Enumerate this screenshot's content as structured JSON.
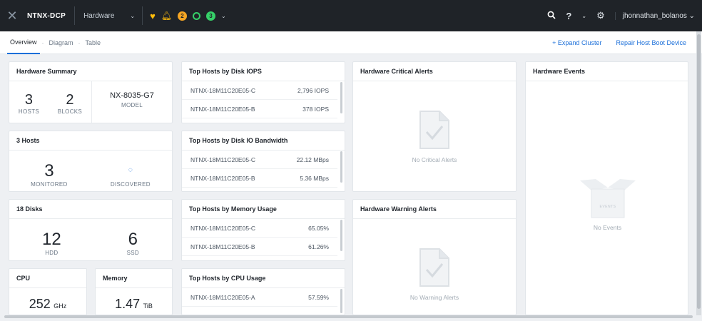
{
  "header": {
    "cluster": "NTNX-DCP",
    "entity": "Hardware",
    "health_icon": "heart-pulse-icon",
    "alerts_count": "2",
    "alerts_color": "#f6a623",
    "tasks_count": "3",
    "tasks_color": "#36d068",
    "user": "jhonnathan_bolanos"
  },
  "subnav": {
    "tabs": [
      "Overview",
      "Diagram",
      "Table"
    ],
    "expand_cluster": "+ Expand Cluster",
    "repair": "Repair Host Boot Device"
  },
  "hardware_summary": {
    "title": "Hardware Summary",
    "hosts_value": "3",
    "hosts_label": "HOSTS",
    "blocks_value": "2",
    "blocks_label": "BLOCKS",
    "model_value": "NX-8035-G7",
    "model_label": "MODEL"
  },
  "hosts": {
    "title": "3 Hosts",
    "monitored_value": "3",
    "monitored_label": "MONITORED",
    "discovered_label": "DISCOVERED"
  },
  "disks": {
    "title": "18 Disks",
    "hdd_value": "12",
    "hdd_label": "HDD",
    "ssd_value": "6",
    "ssd_label": "SSD"
  },
  "cpu": {
    "title": "CPU",
    "value": "252",
    "unit": "GHz"
  },
  "memory": {
    "title": "Memory",
    "value": "1.47",
    "unit": "TiB"
  },
  "iops": {
    "title": "Top Hosts by Disk IOPS",
    "rows": [
      {
        "host": "NTNX-18M11C20E05-C",
        "value": "2,796 IOPS"
      },
      {
        "host": "NTNX-18M11C20E05-B",
        "value": "378 IOPS"
      }
    ]
  },
  "bandwidth": {
    "title": "Top Hosts by Disk IO Bandwidth",
    "rows": [
      {
        "host": "NTNX-18M11C20E05-C",
        "value": "22.12 MBps"
      },
      {
        "host": "NTNX-18M11C20E05-B",
        "value": "5.36 MBps"
      }
    ]
  },
  "mem_usage": {
    "title": "Top Hosts by Memory Usage",
    "rows": [
      {
        "host": "NTNX-18M11C20E05-C",
        "value": "65.05%"
      },
      {
        "host": "NTNX-18M11C20E05-B",
        "value": "61.26%"
      }
    ]
  },
  "cpu_usage": {
    "title": "Top Hosts by CPU Usage",
    "rows": [
      {
        "host": "NTNX-18M11C20E05-A",
        "value": "57.59%"
      }
    ]
  },
  "critical": {
    "title": "Hardware Critical Alerts",
    "empty": "No Critical Alerts"
  },
  "warning": {
    "title": "Hardware Warning Alerts",
    "empty": "No Warning Alerts"
  },
  "events": {
    "title": "Hardware Events",
    "box_label": "EVENTS",
    "empty": "No Events"
  }
}
